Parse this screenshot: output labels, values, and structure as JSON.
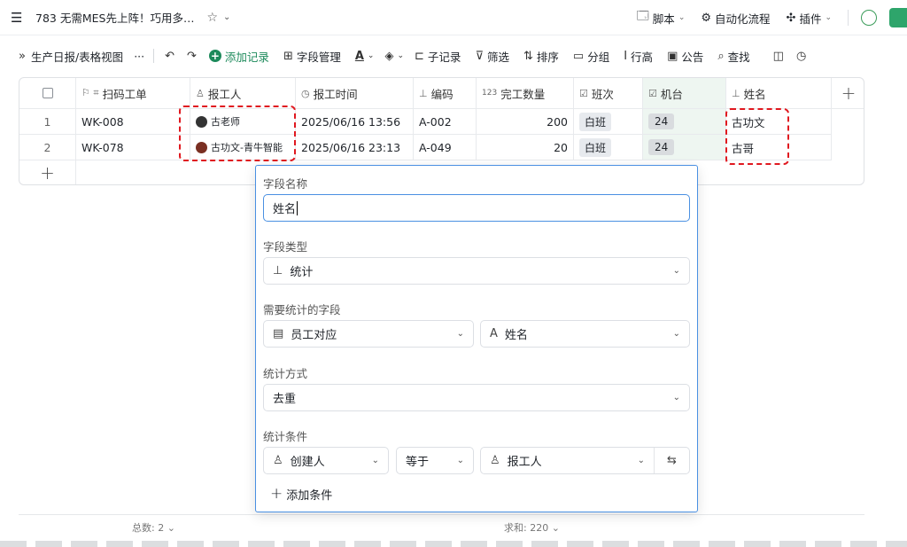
{
  "titlebar": {
    "title": "783 无需MES先上阵！巧用多…",
    "script_label": "脚本",
    "automation_label": "自动化流程",
    "plugin_label": "插件"
  },
  "toolbar": {
    "view_name": "生产日报/表格视图",
    "more": "···",
    "add_record": "添加记录",
    "field_manage": "字段管理",
    "sub_record": "子记录",
    "filter": "筛选",
    "sort": "排序",
    "group": "分组",
    "row_height": "行高",
    "notice": "公告",
    "search": "查找"
  },
  "grid": {
    "columns": [
      {
        "label": "扫码工单",
        "icon": "scan-icon"
      },
      {
        "label": "报工人",
        "icon": "user-icon"
      },
      {
        "label": "报工时间",
        "icon": "clock-icon"
      },
      {
        "label": "编码",
        "icon": "stats-icon"
      },
      {
        "label": "完工数量",
        "icon": "number-icon",
        "icon_text": "123"
      },
      {
        "label": "班次",
        "icon": "select-icon"
      },
      {
        "label": "机台",
        "icon": "select-icon"
      },
      {
        "label": "姓名",
        "icon": "stats-icon"
      }
    ],
    "rows": [
      {
        "num": "1",
        "order": "WK-008",
        "reporter": "古老师",
        "time": "2025/06/16 13:56",
        "code": "A-002",
        "qty": "200",
        "shift": "白班",
        "machine": "24",
        "name": "古功文"
      },
      {
        "num": "2",
        "order": "WK-078",
        "reporter": "古功文-青牛智能",
        "time": "2025/06/16 23:13",
        "code": "A-049",
        "qty": "20",
        "shift": "白班",
        "machine": "24",
        "name": "古哥"
      }
    ],
    "add_row": "+",
    "add_col": "+"
  },
  "footer": {
    "count": "总数: 2",
    "sum": "求和: 220"
  },
  "popup": {
    "field_name_label": "字段名称",
    "field_name_value": "姓名",
    "field_type_label": "字段类型",
    "field_type_value": "统计",
    "stat_field_label": "需要统计的字段",
    "stat_table": "员工对应",
    "stat_field": "姓名",
    "stat_method_label": "统计方式",
    "stat_method": "去重",
    "condition_label": "统计条件",
    "cond_left": "创建人",
    "cond_op": "等于",
    "cond_right": "报工人",
    "add_condition": "添加条件"
  },
  "colors": {
    "accent": "#4a90e2",
    "brand_green": "#1d8a5b",
    "highlight_red": "#e0181f"
  }
}
